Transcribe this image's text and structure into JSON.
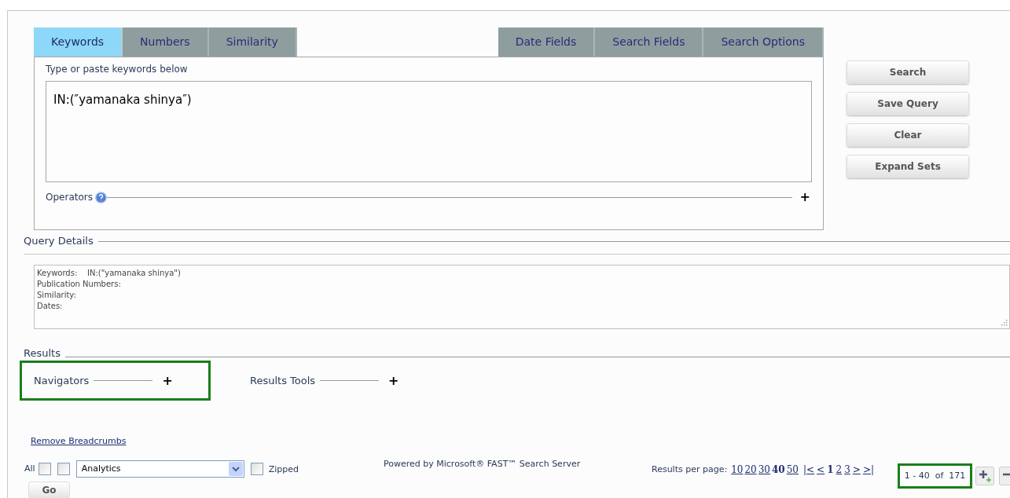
{
  "tabs_left": [
    {
      "label": "Keywords",
      "selected": true
    },
    {
      "label": "Numbers",
      "selected": false
    },
    {
      "label": "Similarity",
      "selected": false
    }
  ],
  "tabs_right": [
    {
      "label": "Date Fields",
      "selected": false
    },
    {
      "label": "Search Fields",
      "selected": false
    },
    {
      "label": "Search Options",
      "selected": false
    }
  ],
  "keywords_panel": {
    "hint": "Type or paste keywords below",
    "value": "IN:(″yamanaka shinya″)",
    "operators_label": "Operators",
    "operators_expand": "+"
  },
  "buttons": [
    "Search",
    "Save Query",
    "Clear",
    "Expand Sets"
  ],
  "query_details": {
    "title": "Query Details",
    "lines": [
      "Keywords:    IN:(\"yamanaka shinya\")",
      "Publication Numbers:",
      "Similarity:",
      "Dates:"
    ]
  },
  "results": {
    "title": "Results",
    "sections": [
      {
        "label": "Navigators",
        "expand": "+",
        "highlighted": true
      },
      {
        "label": "Results Tools",
        "expand": "+",
        "highlighted": false
      }
    ],
    "remove_breadcrumbs": "Remove Breadcrumbs",
    "all_label": "All",
    "checkboxes": [
      {
        "checked": false
      },
      {
        "checked": false
      }
    ],
    "export_select": "Analytics",
    "zipped": {
      "label": "Zipped",
      "checked": false
    },
    "go": "Go",
    "powered_by": "Powered by Microsoft® FAST™ Search Server",
    "per_page_label": "Results per page:",
    "per_page": [
      {
        "label": "10",
        "selected": false
      },
      {
        "label": "20",
        "selected": false
      },
      {
        "label": "30",
        "selected": false
      },
      {
        "label": "40",
        "selected": true
      },
      {
        "label": "50",
        "selected": false
      }
    ],
    "pages": [
      {
        "label": "|<",
        "selected": false
      },
      {
        "label": "<",
        "selected": false
      },
      {
        "label": "1",
        "selected": true
      },
      {
        "label": "2",
        "selected": false
      },
      {
        "label": "3",
        "selected": false
      },
      {
        "label": ">",
        "selected": false
      },
      {
        "label": ">|",
        "selected": false
      }
    ],
    "range": "1 - 40  of  171"
  }
}
